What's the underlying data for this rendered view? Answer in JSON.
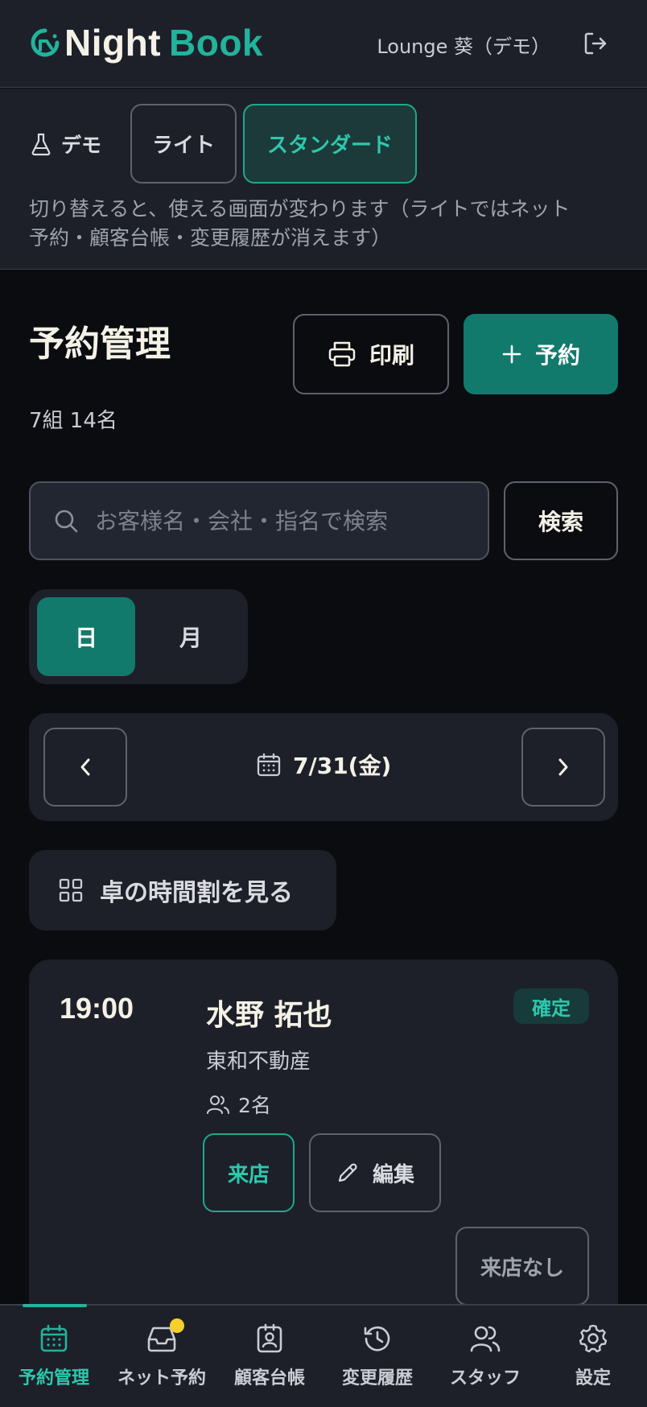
{
  "header": {
    "logo_part1": "Night",
    "logo_part2": "Book",
    "user_label": "Lounge 葵（デモ）"
  },
  "demo": {
    "label": "デモ",
    "plans": [
      "ライト",
      "スタンダード"
    ],
    "selected_plan": "スタンダード",
    "note": "切り替えると、使える画面が変わります（ライトではネット予約・顧客台帳・変更履歴が消えます）"
  },
  "page": {
    "title": "予約管理",
    "count": "7組 14名",
    "print_label": "印刷",
    "add_label": "予約"
  },
  "search": {
    "placeholder": "お客様名・会社・指名で検索",
    "value": "",
    "button_label": "検索"
  },
  "view_toggle": {
    "day": "日",
    "month": "月",
    "selected": "日"
  },
  "date_nav": {
    "date": "7/31(金)"
  },
  "table_grid_label": "卓の時間割を見る",
  "reservations": [
    {
      "time": "19:00",
      "name": "水野 拓也",
      "company": "東和不動産",
      "party": "2名",
      "status": "確定",
      "visit_label": "来店",
      "edit_label": "編集",
      "noshow_label": "来店なし"
    }
  ],
  "bottom_nav": {
    "items": [
      {
        "label": "予約管理",
        "icon": "calendar-icon",
        "active": true
      },
      {
        "label": "ネット予約",
        "icon": "inbox-icon",
        "badge": true
      },
      {
        "label": "顧客台帳",
        "icon": "contact-book-icon"
      },
      {
        "label": "変更履歴",
        "icon": "history-icon"
      },
      {
        "label": "スタッフ",
        "icon": "users-icon"
      },
      {
        "label": "設定",
        "icon": "gear-icon"
      }
    ]
  },
  "colors": {
    "background": "#0b0c10",
    "surface": "#1d2029",
    "accent": "#22b39d",
    "primary_button": "#127a6c",
    "badge_dot": "#f5cf2a"
  }
}
